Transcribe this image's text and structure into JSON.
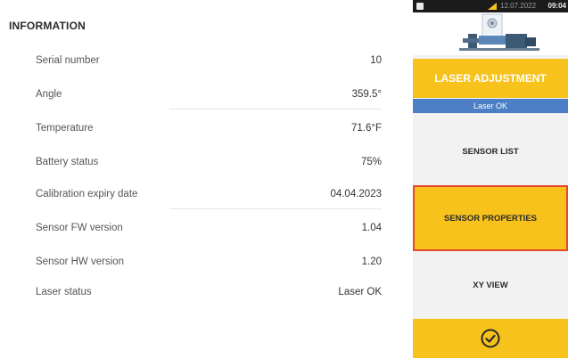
{
  "information": {
    "title": "INFORMATION",
    "rows": [
      {
        "label": "Serial number",
        "value": "10"
      },
      {
        "label": "Angle",
        "value": "359.5°"
      },
      {
        "label": "Temperature",
        "value": "71.6°F"
      },
      {
        "label": "Battery status",
        "value": "75%"
      },
      {
        "label": "Calibration expiry date",
        "value": "04.04.2023"
      },
      {
        "label": "Sensor FW version",
        "value": "1.04"
      },
      {
        "label": "Sensor HW version",
        "value": "1.20"
      },
      {
        "label": "Laser status",
        "value": "Laser OK"
      }
    ]
  },
  "statusbar": {
    "date": "12.07.2022",
    "time": "09:04"
  },
  "menu": {
    "laser_adjustment": "LASER ADJUSTMENT",
    "laser_ok": "Laser OK",
    "sensor_list": "SENSOR LIST",
    "sensor_properties": "SENSOR PROPERTIES",
    "xy_view": "XY VIEW"
  },
  "colors": {
    "accent": "#f7c21c",
    "selected_border": "#e4482f",
    "status_blue": "#4c7fc6"
  },
  "icons": {
    "confirm": "check-circle-icon",
    "machine": "machine-train-icon"
  }
}
